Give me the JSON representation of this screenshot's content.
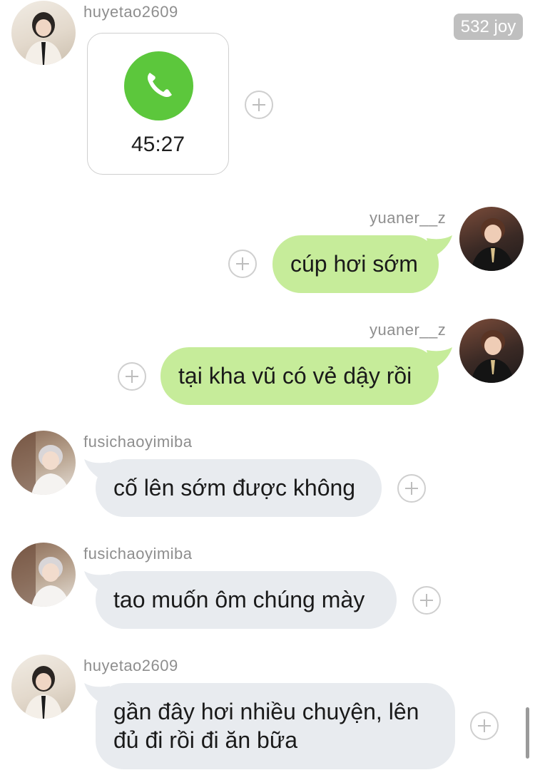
{
  "badge": {
    "text": "532 joy"
  },
  "messages": [
    {
      "user": "huyetao2609",
      "type": "call",
      "duration": "45:27"
    },
    {
      "user": "yuaner__z",
      "type": "text",
      "text": "cúp hơi sớm"
    },
    {
      "user": "yuaner__z",
      "type": "text",
      "text": "tại kha vũ có vẻ dậy rồi"
    },
    {
      "user": "fusichaoyimiba",
      "type": "text",
      "text": "cố lên sớm được không"
    },
    {
      "user": "fusichaoyimiba",
      "type": "text",
      "text": "tao muốn ôm chúng mày"
    },
    {
      "user": "huyetao2609",
      "type": "text",
      "text": "gần đây hơi nhiều chuyện, lên đủ đi rồi đi ăn bữa"
    }
  ],
  "colors": {
    "outgoing_bubble": "#c6ec9a",
    "incoming_bubble": "#e8ebef",
    "call_green": "#5cc73c",
    "username_gray": "#8e8e8e"
  },
  "icons": [
    "phone-icon",
    "plus-icon"
  ]
}
